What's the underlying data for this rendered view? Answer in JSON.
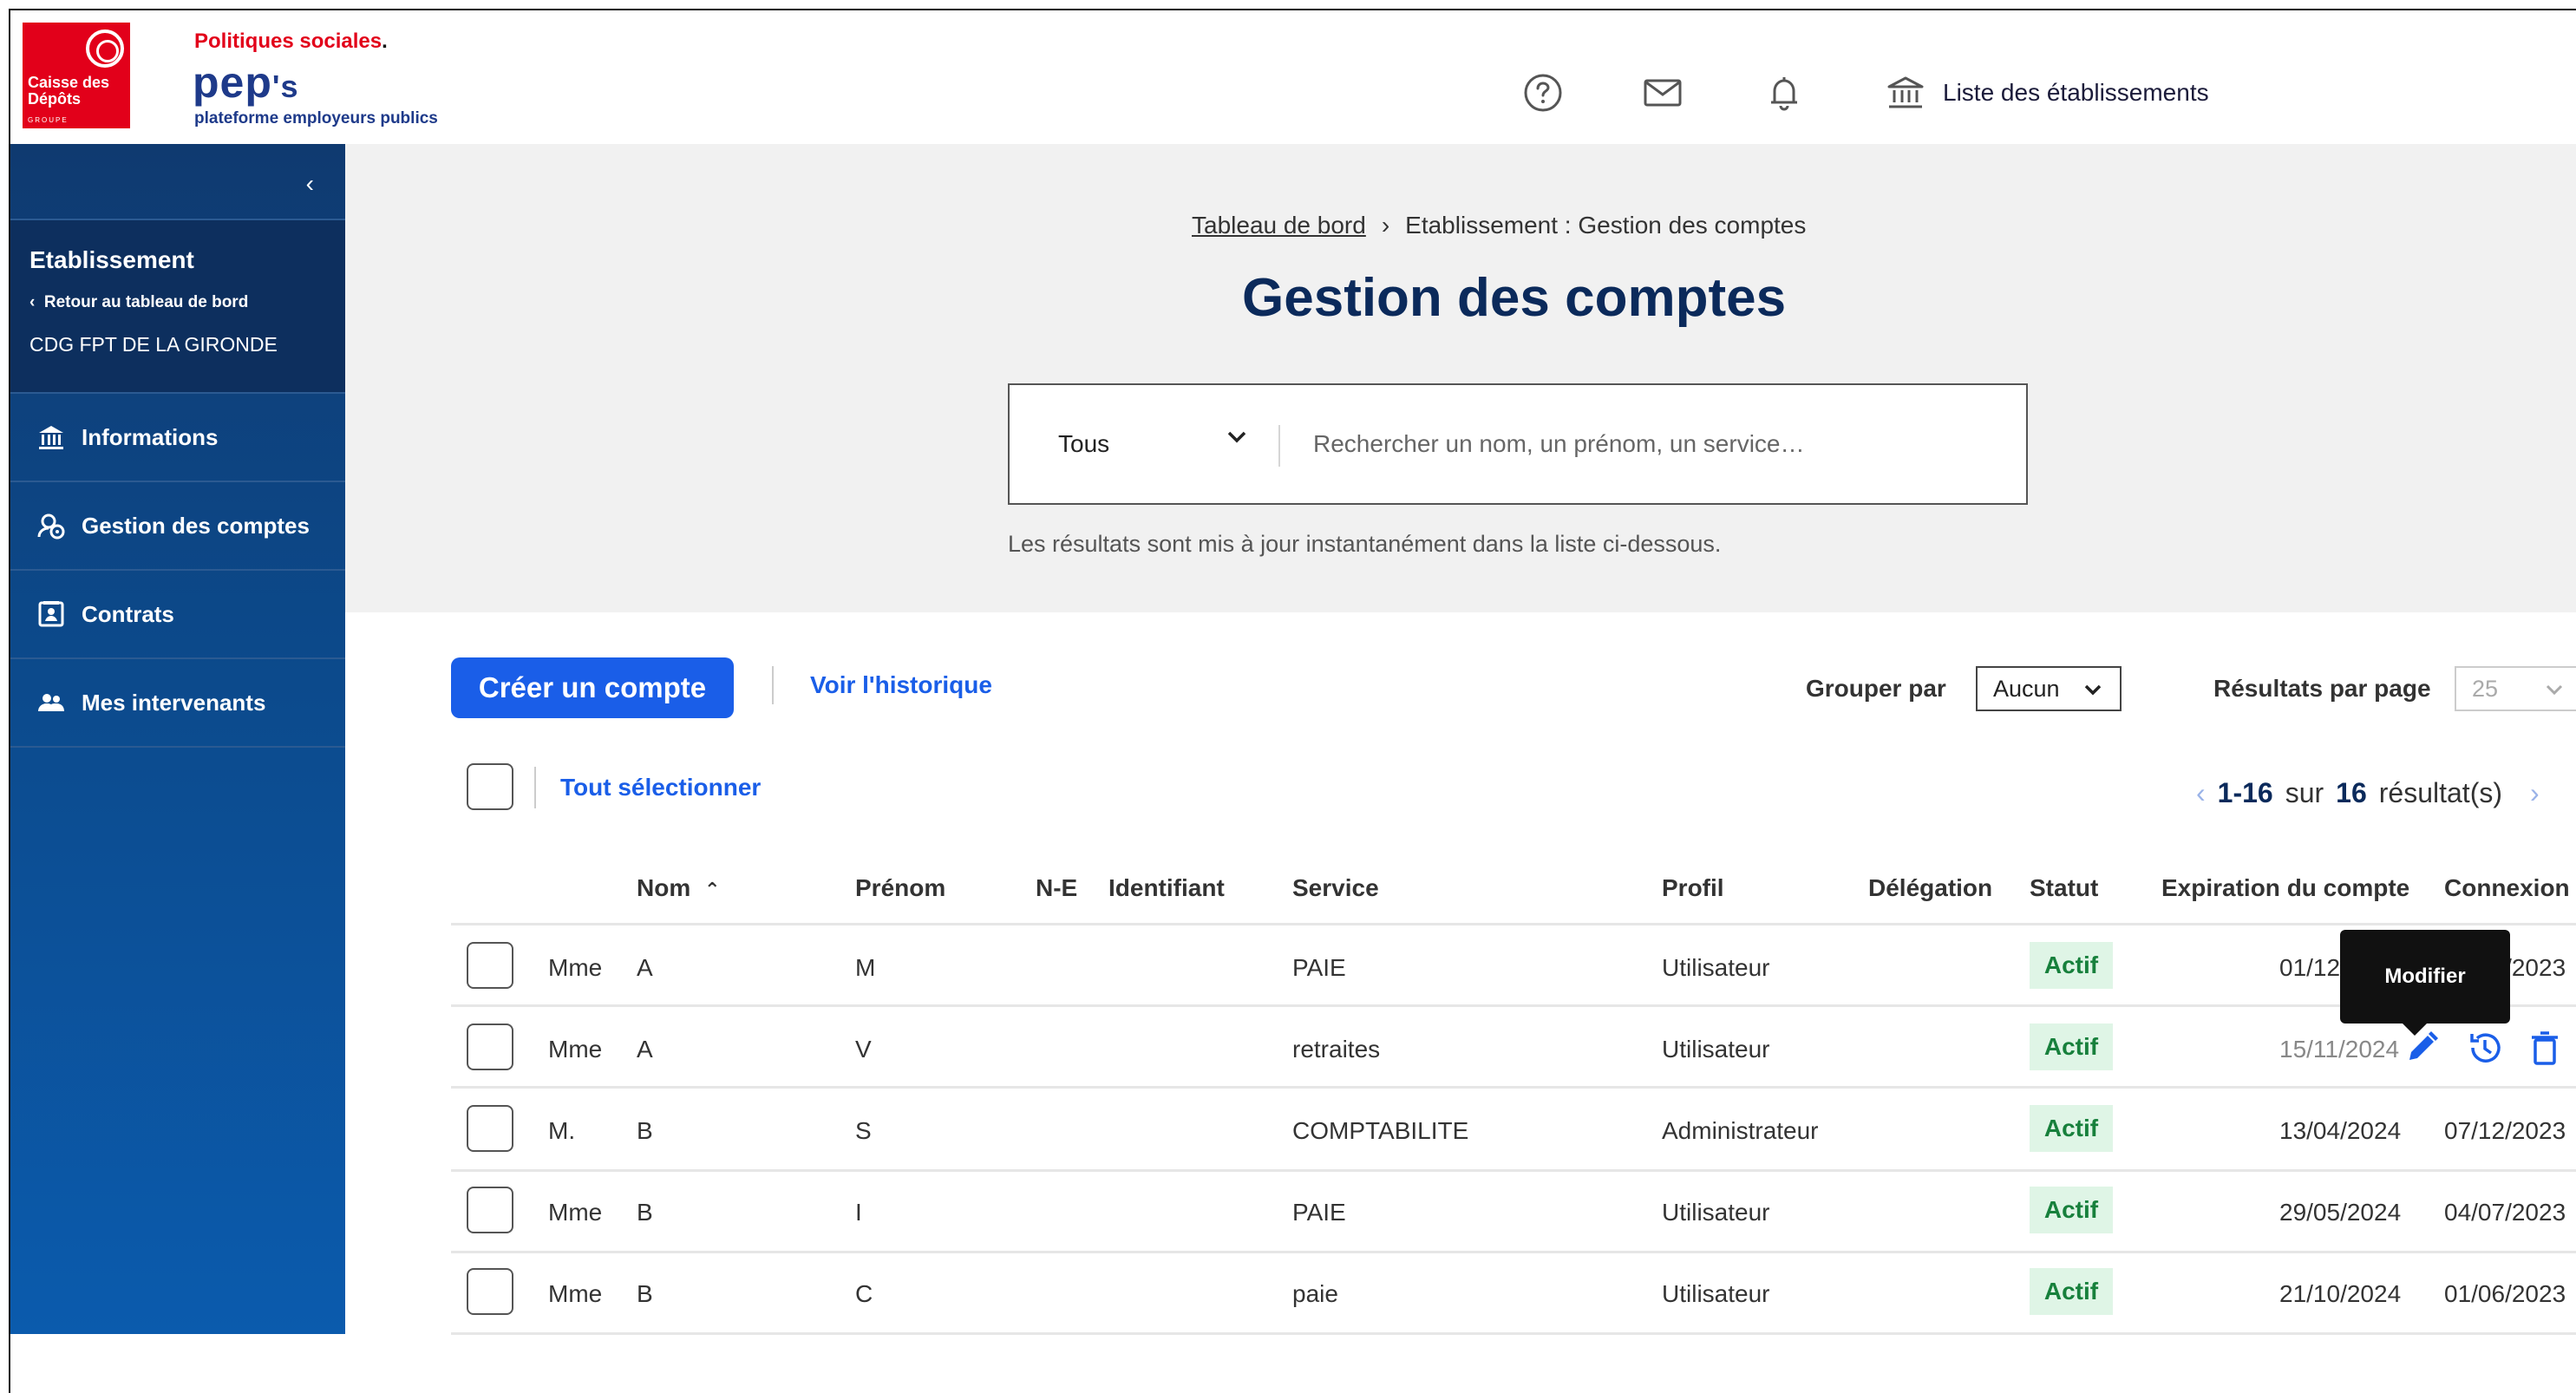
{
  "header": {
    "brand_org": "Caisse des Dépôts",
    "brand_group": "GROUPE",
    "brand_top": "Politiques sociales",
    "brand_name": "pep",
    "brand_name_suffix": "'s",
    "brand_tagline": "plateforme employeurs publics",
    "icons": [
      "help-icon",
      "mail-icon",
      "bell-icon",
      "institution-icon"
    ],
    "establishments_label": "Liste des établissements"
  },
  "sidebar": {
    "collapse_icon": "chevron-left-icon",
    "context": {
      "title": "Etablissement",
      "back_label": "Retour au tableau de bord",
      "establishment_name": "CDG FPT DE LA GIRONDE"
    },
    "items": [
      {
        "label": "Informations",
        "icon": "institution-icon"
      },
      {
        "label": "Gestion des comptes",
        "icon": "accounts-icon"
      },
      {
        "label": "Contrats",
        "icon": "contract-icon"
      },
      {
        "label": "Mes intervenants",
        "icon": "people-icon"
      }
    ]
  },
  "breadcrumb": {
    "home": "Tableau de bord",
    "separator": "›",
    "current": "Etablissement : Gestion des comptes"
  },
  "page_title": "Gestion des comptes",
  "search": {
    "filter_value": "Tous",
    "placeholder": "Rechercher un nom, un prénom, un service…",
    "hint": "Les résultats sont mis à jour instantanément dans la liste ci-dessous."
  },
  "toolbar": {
    "create_label": "Créer un compte",
    "history_label": "Voir l'historique",
    "group_by_label": "Grouper par",
    "group_by_value": "Aucun",
    "per_page_label": "Résultats par page",
    "per_page_value": "25",
    "select_all_label": "Tout sélectionner"
  },
  "pagination": {
    "range": "1-16",
    "sur": "sur",
    "total": "16",
    "suffix": "résultat(s)"
  },
  "table": {
    "headers": {
      "nom": "Nom",
      "sort_indicator": "⌃",
      "prenom": "Prénom",
      "ne": "N-E",
      "identifiant": "Identifiant",
      "service": "Service",
      "profil": "Profil",
      "delegation": "Délégation",
      "statut": "Statut",
      "expiration": "Expiration du compte",
      "connexion": "Connexion"
    },
    "rows": [
      {
        "civ": "Mme",
        "nom": "A",
        "prenom": "M",
        "service": "PAIE",
        "profil": "Utilisateur",
        "statut": "Actif",
        "expiration": "01/12/2024",
        "connexion": "25/07/2023"
      },
      {
        "civ": "Mme",
        "nom": "A",
        "prenom": "V",
        "service": "retraites",
        "profil": "Utilisateur",
        "statut": "Actif",
        "expiration": "15/11/2024",
        "connexion": ""
      },
      {
        "civ": "M.",
        "nom": "B",
        "prenom": "S",
        "service": "COMPTABILITE",
        "profil": "Administrateur",
        "statut": "Actif",
        "expiration": "13/04/2024",
        "connexion": "07/12/2023"
      },
      {
        "civ": "Mme",
        "nom": "B",
        "prenom": "I",
        "service": "PAIE",
        "profil": "Utilisateur",
        "statut": "Actif",
        "expiration": "29/05/2024",
        "connexion": "04/07/2023"
      },
      {
        "civ": "Mme",
        "nom": "B",
        "prenom": "C",
        "service": "paie",
        "profil": "Utilisateur",
        "statut": "Actif",
        "expiration": "21/10/2024",
        "connexion": "01/06/2023"
      }
    ],
    "row_actions": [
      "edit-icon",
      "history-icon",
      "delete-icon"
    ],
    "tooltip": "Modifier"
  },
  "colors": {
    "brand_red": "#e2001a",
    "primary_blue": "#1a5ee8",
    "navy": "#0b2a5b",
    "status_bg": "#dff5e6",
    "status_text": "#17803c"
  }
}
